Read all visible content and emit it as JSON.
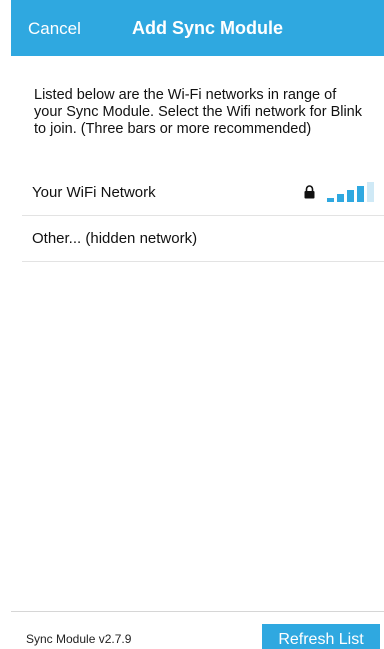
{
  "header": {
    "cancel_label": "Cancel",
    "title": "Add Sync Module"
  },
  "intro_text": "Listed below are the Wi-Fi networks in range of your Sync Module. Select the Wifi network for Blink to join. (Three bars or more recommended)",
  "networks": [
    {
      "name": "Your WiFi Network",
      "secured": true,
      "signal_bars": 4,
      "signal_bars_max": 5,
      "icons": [
        "lock-icon",
        "wifi-bars-icon"
      ]
    },
    {
      "name": "Other...  (hidden network)"
    }
  ],
  "footer": {
    "version": "Sync Module v2.7.9",
    "refresh_label": "Refresh List"
  },
  "colors": {
    "accent": "#2fa8e0",
    "header_text": "#ffffff",
    "signal_active": "#2fa8e0",
    "signal_inactive": "#cfe9f6"
  }
}
